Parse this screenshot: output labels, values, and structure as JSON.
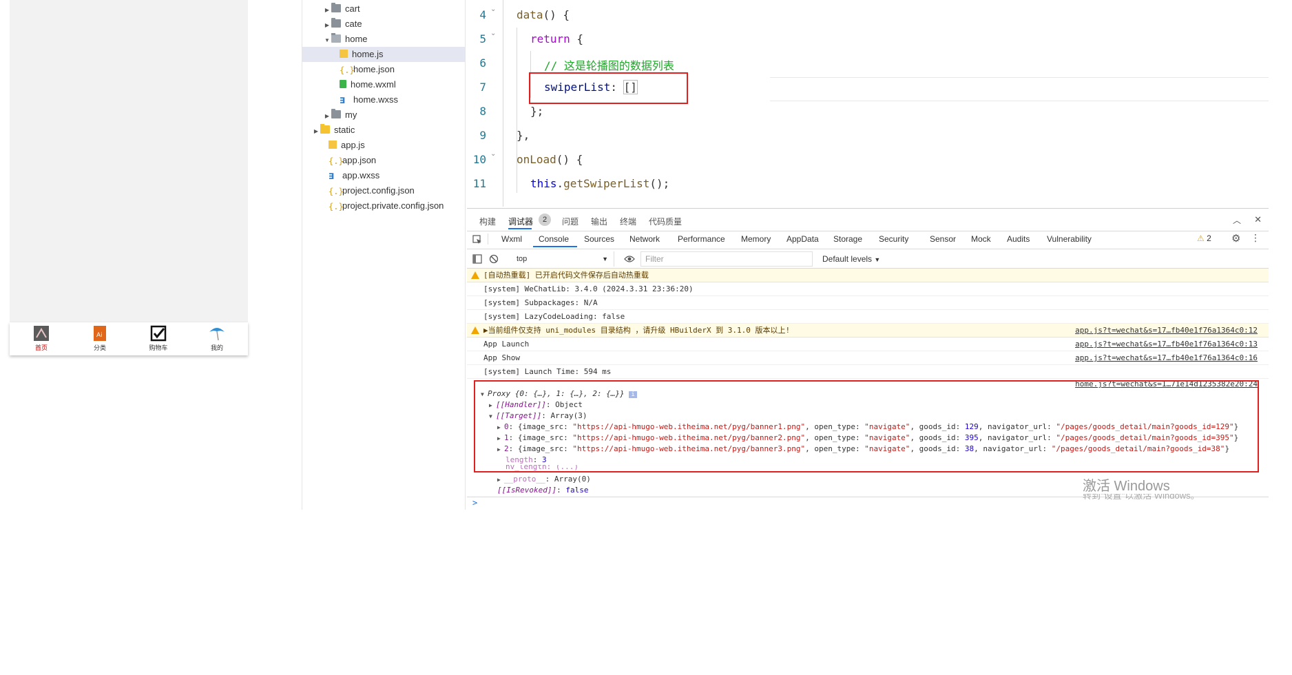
{
  "simulator": {
    "tabs": [
      {
        "label": "首页",
        "active": true
      },
      {
        "label": "分类",
        "active": false
      },
      {
        "label": "购物车",
        "active": false
      },
      {
        "label": "我的",
        "active": false
      }
    ]
  },
  "explorer": {
    "items": [
      {
        "label": "cart"
      },
      {
        "label": "cate"
      },
      {
        "label": "home"
      },
      {
        "label": "home.js"
      },
      {
        "label": "home.json"
      },
      {
        "label": "home.wxml"
      },
      {
        "label": "home.wxss"
      },
      {
        "label": "my"
      },
      {
        "label": "static"
      },
      {
        "label": "app.js"
      },
      {
        "label": "app.json"
      },
      {
        "label": "app.wxss"
      },
      {
        "label": "project.config.json"
      },
      {
        "label": "project.private.config.json"
      }
    ]
  },
  "editor": {
    "line_numbers": [
      "4",
      "5",
      "6",
      "7",
      "8",
      "9",
      "10",
      "11"
    ],
    "lines": {
      "l4_fn": "data",
      "l4_rest": "() {",
      "l5_kw": "return",
      "l5_rest": " {",
      "l6_comment": "// 这是轮播图的数据列表",
      "l7_prop": "swiperList",
      "l7_colon": ": ",
      "l7_val": "[]",
      "l8": "};",
      "l9": "},",
      "l10_fn": "onLoad",
      "l10_rest": "() {",
      "l11_this": "this",
      "l11_dot": ".",
      "l11_fn": "getSwiperList",
      "l11_rest": "();"
    }
  },
  "devtools": {
    "top_tabs": {
      "build": "构建",
      "debugger": "调试器",
      "badge": "2",
      "issues": "问题",
      "output": "输出",
      "terminal": "终端",
      "quality": "代码质量"
    },
    "panel_tabs": [
      "Wxml",
      "Console",
      "Sources",
      "Network",
      "Performance",
      "Memory",
      "AppData",
      "Storage",
      "Security",
      "Sensor",
      "Mock",
      "Audits",
      "Vulnerability"
    ],
    "warning_count": "2",
    "context": "top",
    "filter_placeholder": "Filter",
    "levels": "Default levels"
  },
  "console": {
    "lines": [
      {
        "text": "[自动热重载] 已开启代码文件保存后自动热重载",
        "warn": true,
        "src": ""
      },
      {
        "text": "[system] WeChatLib: 3.4.0 (2024.3.31 23:36:20)",
        "warn": false,
        "src": ""
      },
      {
        "text": "[system] Subpackages: N/A",
        "warn": false,
        "src": ""
      },
      {
        "text": "[system] LazyCodeLoading: false",
        "warn": false,
        "src": ""
      },
      {
        "text": "▶当前组件仅支持 uni_modules 目录结构 ，请升级 HBuilderX 到 3.1.0 版本以上!",
        "warn": true,
        "src": "app.js?t=wechat&s=17…fb40e1f76a1364c0:12"
      },
      {
        "text": "App Launch",
        "warn": false,
        "src": "app.js?t=wechat&s=17…fb40e1f76a1364c0:13"
      },
      {
        "text": "App Show",
        "warn": false,
        "src": "app.js?t=wechat&s=17…fb40e1f76a1364c0:16"
      },
      {
        "text": "[system] Launch Time: 594 ms",
        "warn": false,
        "src": ""
      }
    ],
    "object_src": "home.js?t=wechat&s=1…71e14d1235382e20:24",
    "proxy_head": "Proxy {0: {…}, 1: {…}, 2: {…}}",
    "handler_key": "[[Handler]]",
    "handler_val": ": Object",
    "target_key": "[[Target]]",
    "target_val": ": Array(3)",
    "items": [
      {
        "idx": "0",
        "image_src": "\"https://api-hmugo-web.itheima.net/pyg/banner1.png\"",
        "open_type": "\"navigate\"",
        "goods_id": "129",
        "navigator_url": "\"/pages/goods_detail/main?goods_id=129\""
      },
      {
        "idx": "1",
        "image_src": "\"https://api-hmugo-web.itheima.net/pyg/banner2.png\"",
        "open_type": "\"navigate\"",
        "goods_id": "395",
        "navigator_url": "\"/pages/goods_detail/main?goods_id=395\""
      },
      {
        "idx": "2",
        "image_src": "\"https://api-hmugo-web.itheima.net/pyg/banner3.png\"",
        "open_type": "\"navigate\"",
        "goods_id": "38",
        "navigator_url": "\"/pages/goods_detail/main?goods_id=38\""
      }
    ],
    "length_key": "length",
    "length_val": "3",
    "nv_length": "nv_length: (...)",
    "proto_key": "__proto__",
    "proto_val": ": Array(0)",
    "revoked_key": "[[IsRevoked]]",
    "revoked_val": "false",
    "prompt": ">"
  },
  "watermark": {
    "title": "激活 Windows",
    "sub": "转到\"设置\"以激活 Windows。"
  }
}
